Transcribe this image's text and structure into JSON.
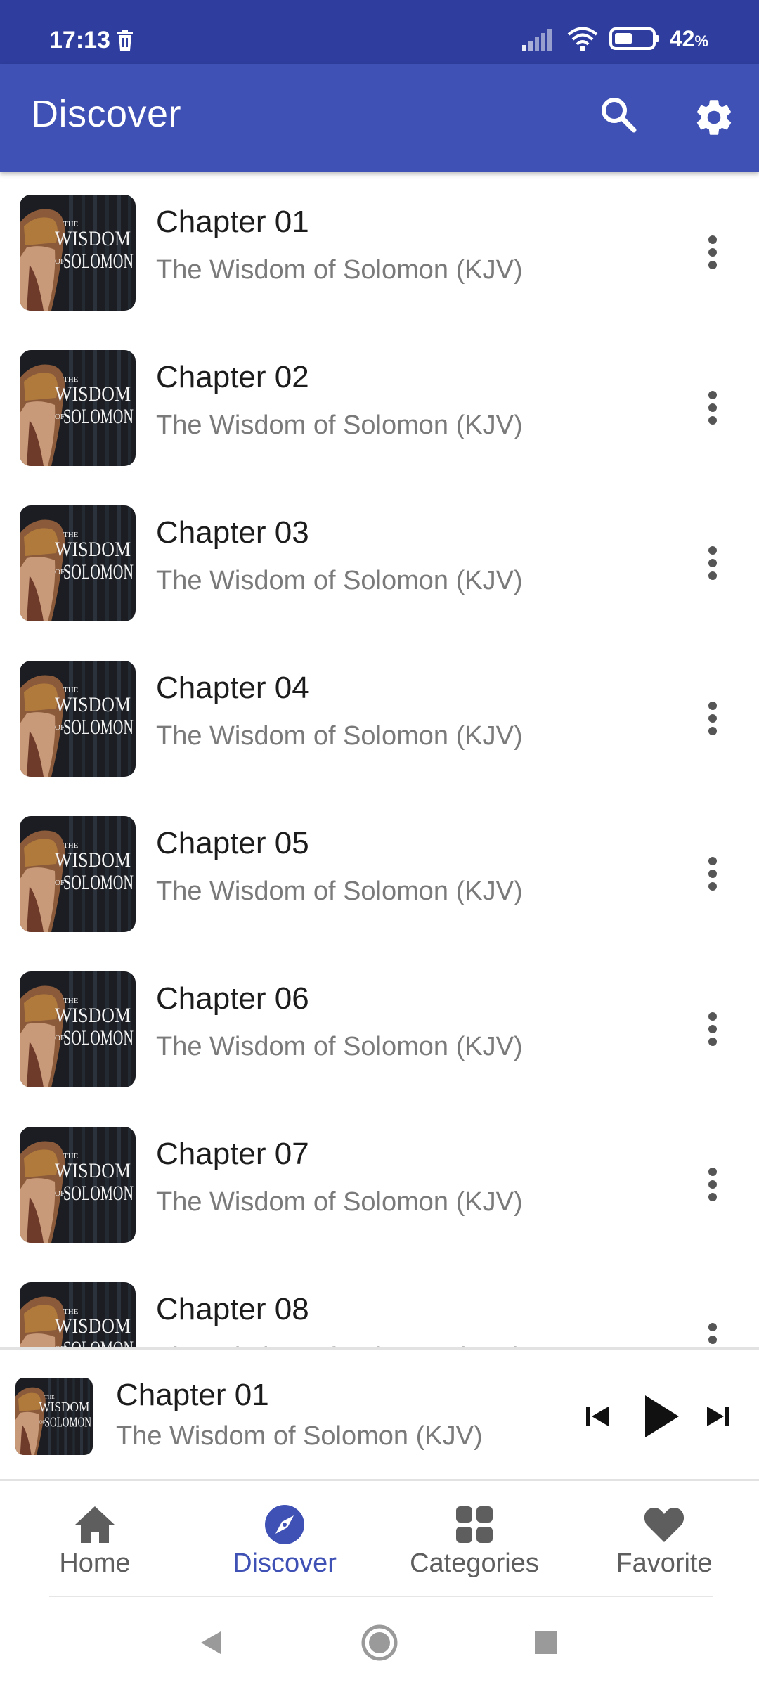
{
  "status": {
    "time": "17:13",
    "battery": "42",
    "battery_unit": "%"
  },
  "app_bar": {
    "title": "Discover"
  },
  "list": {
    "items": [
      {
        "title": "Chapter 01",
        "subtitle": "The Wisdom of Solomon (KJV)"
      },
      {
        "title": "Chapter 02",
        "subtitle": "The Wisdom of Solomon (KJV)"
      },
      {
        "title": "Chapter 03",
        "subtitle": "The Wisdom of Solomon (KJV)"
      },
      {
        "title": "Chapter 04",
        "subtitle": "The Wisdom of Solomon (KJV)"
      },
      {
        "title": "Chapter 05",
        "subtitle": "The Wisdom of Solomon (KJV)"
      },
      {
        "title": "Chapter 06",
        "subtitle": "The Wisdom of Solomon (KJV)"
      },
      {
        "title": "Chapter 07",
        "subtitle": "The Wisdom of Solomon (KJV)"
      },
      {
        "title": "Chapter 08",
        "subtitle": "The Wisdom of Solomon (KJV)"
      }
    ]
  },
  "cover": {
    "line1": "THE",
    "line2": "WISDOM",
    "line3": "OF",
    "line4": "SOLOMON"
  },
  "player": {
    "title": "Chapter 01",
    "subtitle": "The Wisdom of Solomon (KJV)"
  },
  "nav": {
    "home": "Home",
    "discover": "Discover",
    "categories": "Categories",
    "favorite": "Favorite"
  },
  "colors": {
    "primary": "#3f51b5",
    "status_bar": "#2f3e9e",
    "text_secondary": "#7a7a7a"
  }
}
